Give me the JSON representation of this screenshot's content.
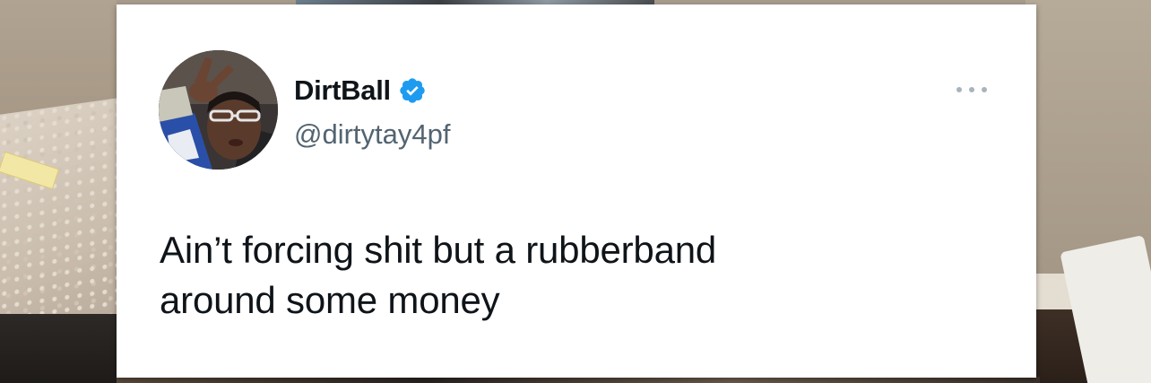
{
  "tweet": {
    "display_name": "DirtBall",
    "handle": "@dirtytay4pf",
    "verified": true,
    "text_lines": [
      "Ain’t forcing shit but a rubberband",
      "around some money"
    ]
  },
  "icons": {
    "verified": "verified-badge-icon",
    "more": "more-options-icon"
  },
  "colors": {
    "card_background": "#ffffff",
    "name": "#0f1419",
    "handle": "#536471",
    "verified_badge": "#1d9bf0",
    "more_dots": "#a9b3bc"
  }
}
